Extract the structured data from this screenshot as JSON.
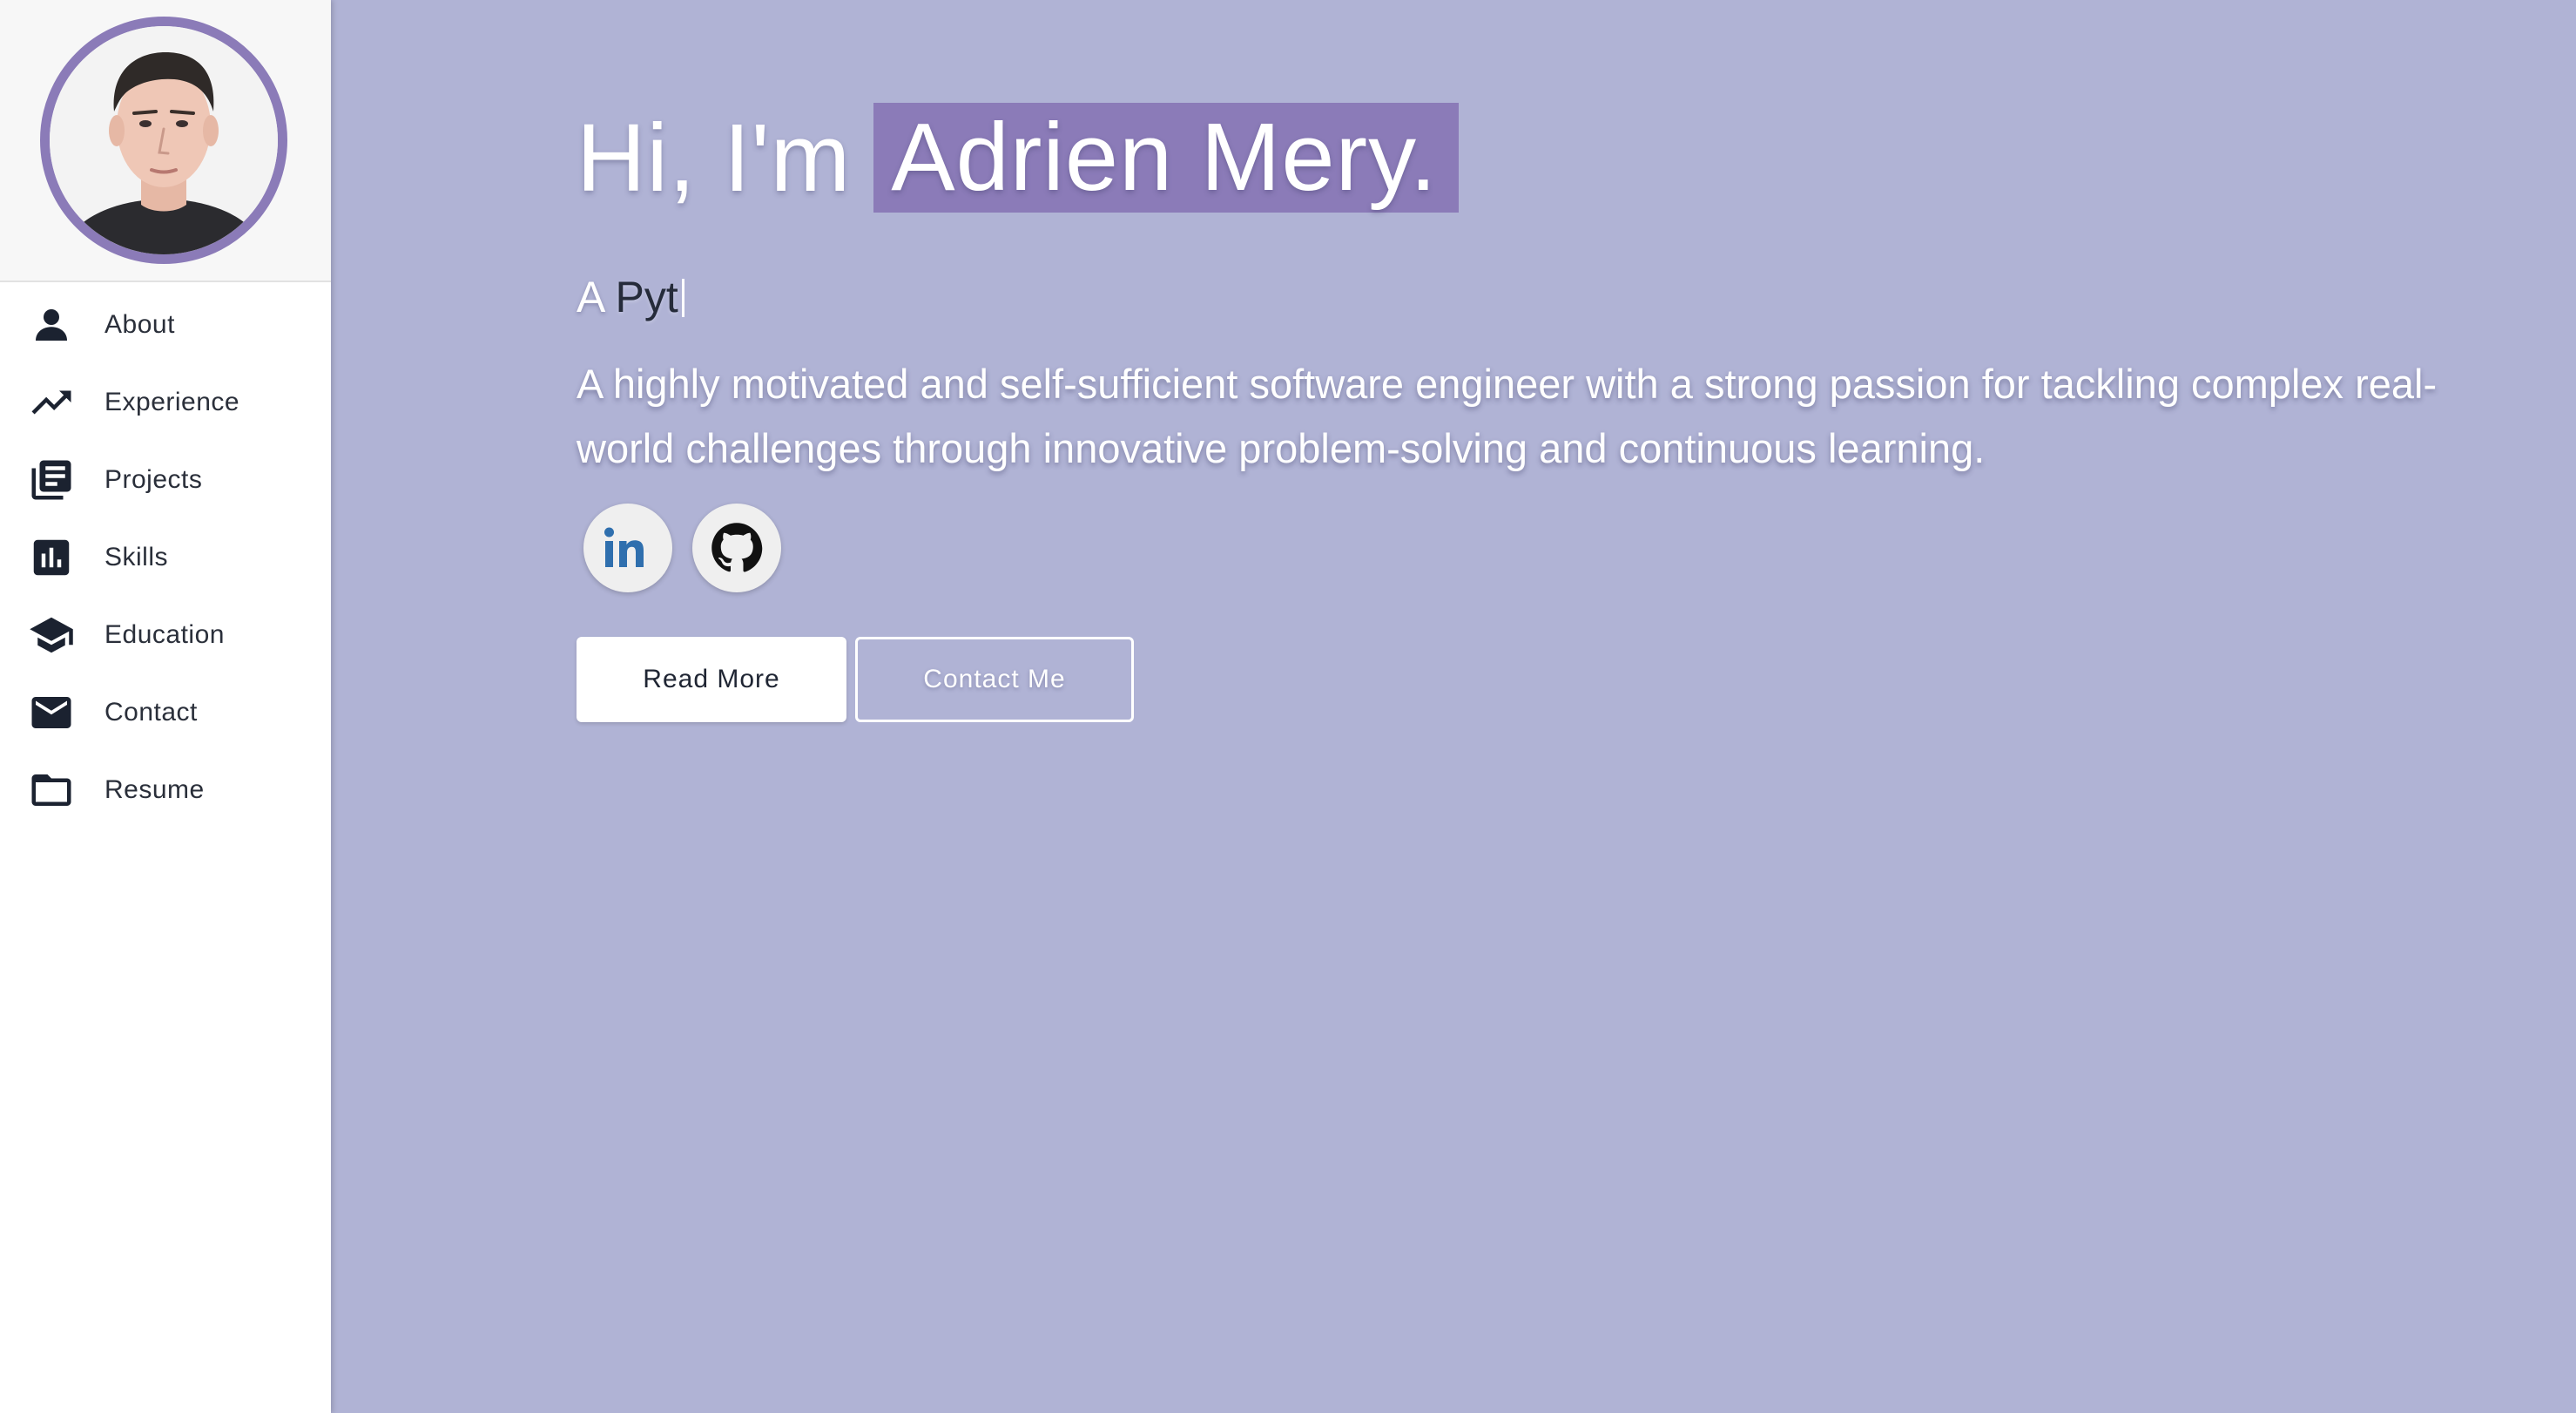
{
  "sidebar": {
    "items": [
      {
        "label": "About",
        "icon": "person-icon"
      },
      {
        "label": "Experience",
        "icon": "trending-up-icon"
      },
      {
        "label": "Projects",
        "icon": "library-books-icon"
      },
      {
        "label": "Skills",
        "icon": "bar-chart-icon"
      },
      {
        "label": "Education",
        "icon": "graduation-cap-icon"
      },
      {
        "label": "Contact",
        "icon": "mail-icon"
      },
      {
        "label": "Resume",
        "icon": "folder-icon"
      }
    ]
  },
  "hero": {
    "greeting": "Hi, I'm",
    "name": "Adrien Mery.",
    "subtitle_prefix": "A",
    "subtitle_typed": "Pyt",
    "description": "A highly motivated and self-sufficient software engineer with a strong passion for tackling complex real-world challenges through innovative problem-solving and continuous learning.",
    "read_more_label": "Read More",
    "contact_label": "Contact Me"
  },
  "social": [
    {
      "name": "linkedin-icon",
      "text": "in"
    },
    {
      "name": "github-icon"
    }
  ],
  "colors": {
    "background": "#b0b3d5",
    "accent": "#8b7bb8",
    "sidebar": "#ffffff",
    "text_dark": "#1b2230"
  }
}
